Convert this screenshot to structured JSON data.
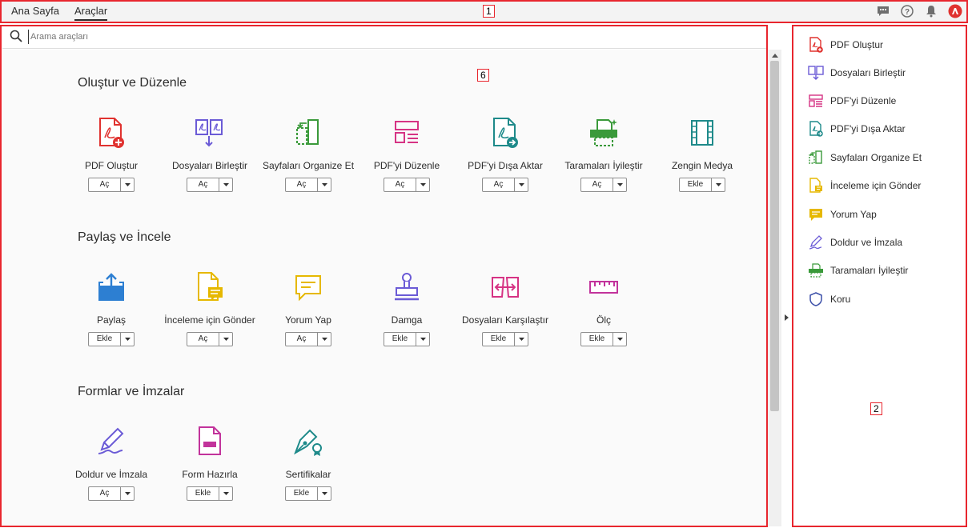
{
  "topbar": {
    "tabs": [
      {
        "label": "Ana Sayfa"
      },
      {
        "label": "Araçlar"
      }
    ]
  },
  "annotations": {
    "top": "1",
    "right": "2",
    "main": "6"
  },
  "search": {
    "placeholder": "Arama araçları",
    "value": ""
  },
  "sections": [
    {
      "title": "Oluştur ve Düzenle",
      "tools": [
        {
          "label": "PDF Oluştur",
          "button": "Aç",
          "icon": "create-pdf-icon"
        },
        {
          "label": "Dosyaları Birleştir",
          "button": "Aç",
          "icon": "combine-files-icon"
        },
        {
          "label": "Sayfaları Organize Et",
          "button": "Aç",
          "icon": "organize-pages-icon"
        },
        {
          "label": "PDF'yi Düzenle",
          "button": "Aç",
          "icon": "edit-pdf-icon"
        },
        {
          "label": "PDF'yi Dışa Aktar",
          "button": "Aç",
          "icon": "export-pdf-icon"
        },
        {
          "label": "Taramaları İyileştir",
          "button": "Aç",
          "icon": "enhance-scans-icon"
        },
        {
          "label": "Zengin Medya",
          "button": "Ekle",
          "icon": "rich-media-icon"
        }
      ]
    },
    {
      "title": "Paylaş ve İncele",
      "tools": [
        {
          "label": "Paylaş",
          "button": "Ekle",
          "icon": "share-icon"
        },
        {
          "label": "İnceleme için Gönder",
          "button": "Aç",
          "icon": "send-for-review-icon"
        },
        {
          "label": "Yorum Yap",
          "button": "Aç",
          "icon": "comment-icon"
        },
        {
          "label": "Damga",
          "button": "Ekle",
          "icon": "stamp-icon"
        },
        {
          "label": "Dosyaları Karşılaştır",
          "button": "Ekle",
          "icon": "compare-files-icon"
        },
        {
          "label": "Ölç",
          "button": "Ekle",
          "icon": "measure-icon"
        }
      ]
    },
    {
      "title": "Formlar ve İmzalar",
      "tools": [
        {
          "label": "Doldur ve İmzala",
          "button": "Aç",
          "icon": "fill-sign-icon"
        },
        {
          "label": "Form Hazırla",
          "button": "Ekle",
          "icon": "prepare-form-icon"
        },
        {
          "label": "Sertifikalar",
          "button": "Ekle",
          "icon": "certificates-icon"
        }
      ]
    }
  ],
  "right_pane": {
    "items": [
      {
        "label": "PDF Oluştur",
        "icon": "create-pdf-icon"
      },
      {
        "label": "Dosyaları Birleştir",
        "icon": "combine-files-icon"
      },
      {
        "label": "PDF'yi Düzenle",
        "icon": "edit-pdf-icon"
      },
      {
        "label": "PDF'yi Dışa Aktar",
        "icon": "export-pdf-icon"
      },
      {
        "label": "Sayfaları Organize Et",
        "icon": "organize-pages-icon"
      },
      {
        "label": "İnceleme için Gönder",
        "icon": "send-for-review-icon"
      },
      {
        "label": "Yorum Yap",
        "icon": "comment-icon"
      },
      {
        "label": "Doldur ve İmzala",
        "icon": "fill-sign-icon"
      },
      {
        "label": "Taramaları İyileştir",
        "icon": "enhance-scans-icon"
      },
      {
        "label": "Koru",
        "icon": "protect-icon"
      }
    ]
  },
  "colors": {
    "annotation": "#e8262e",
    "red": "#e0322f",
    "blue": "#2d7fd2",
    "purple": "#6b5bd6",
    "green": "#3a9a3a",
    "pink": "#d63384",
    "teal": "#1e8a8a",
    "gold": "#e6b800",
    "magenta": "#c2339b"
  }
}
